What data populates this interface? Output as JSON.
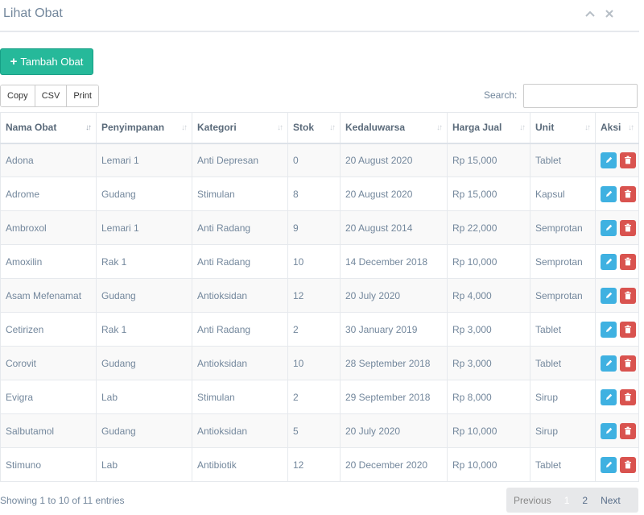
{
  "panel": {
    "title": "Lihat Obat"
  },
  "toolbar": {
    "add_label": "Tambah Obat"
  },
  "export": {
    "copy": "Copy",
    "csv": "CSV",
    "print": "Print"
  },
  "search": {
    "label": "Search:",
    "value": ""
  },
  "table": {
    "headers": [
      "Nama Obat",
      "Penyimpanan",
      "Kategori",
      "Stok",
      "Kedaluwarsa",
      "Harga Jual",
      "Unit",
      "Aksi"
    ],
    "rows": [
      [
        "Adona",
        "Lemari 1",
        "Anti Depresan",
        "0",
        "20 August 2020",
        "Rp 15,000",
        "Tablet"
      ],
      [
        "Adrome",
        "Gudang",
        "Stimulan",
        "8",
        "20 August 2020",
        "Rp 15,000",
        "Kapsul"
      ],
      [
        "Ambroxol",
        "Lemari 1",
        "Anti Radang",
        "9",
        "20 August 2014",
        "Rp 22,000",
        "Semprotan"
      ],
      [
        "Amoxilin",
        "Rak 1",
        "Anti Radang",
        "10",
        "14 December 2018",
        "Rp 10,000",
        "Semprotan"
      ],
      [
        "Asam Mefenamat",
        "Gudang",
        "Antioksidan",
        "12",
        "20 July 2020",
        "Rp 4,000",
        "Semprotan"
      ],
      [
        "Cetirizen",
        "Rak 1",
        "Anti Radang",
        "2",
        "30 January 2019",
        "Rp 3,000",
        "Tablet"
      ],
      [
        "Corovit",
        "Gudang",
        "Antioksidan",
        "10",
        "28 September 2018",
        "Rp 3,000",
        "Tablet"
      ],
      [
        "Evigra",
        "Lab",
        "Stimulan",
        "2",
        "29 September 2018",
        "Rp 8,000",
        "Sirup"
      ],
      [
        "Salbutamol",
        "Gudang",
        "Antioksidan",
        "5",
        "20 July 2020",
        "Rp 10,000",
        "Sirup"
      ],
      [
        "Stimuno",
        "Lab",
        "Antibiotik",
        "12",
        "20 December 2020",
        "Rp 10,000",
        "Tablet"
      ]
    ]
  },
  "footer": {
    "info": "Showing 1 to 10 of 11 entries"
  },
  "pagination": {
    "previous": "Previous",
    "page1": "1",
    "page2": "2",
    "next": "Next"
  },
  "icons": {
    "collapse": "chevron-up-icon",
    "close": "close-icon",
    "add": "plus-icon",
    "edit": "pencil-icon",
    "delete": "trash-icon",
    "sort": "sort-icon"
  },
  "colors": {
    "primary": "#26b99a",
    "edit": "#3fb1e1",
    "delete": "#d9534f"
  }
}
